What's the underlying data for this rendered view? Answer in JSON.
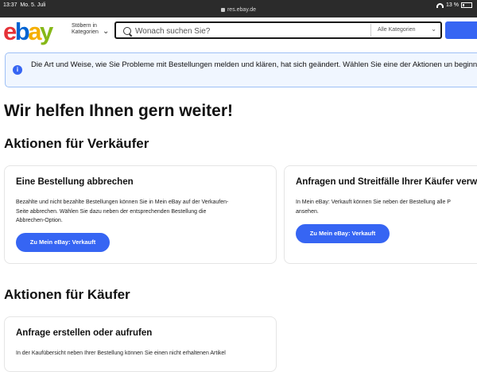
{
  "statusbar": {
    "time": "13:37",
    "date": "Mo. 5. Juli",
    "url": "res.ebay.de",
    "battery": "13 %"
  },
  "header": {
    "logo": [
      "e",
      "b",
      "a",
      "y"
    ],
    "shop_by_category": "Stöbern in Kategorien",
    "search_placeholder": "Wonach suchen Sie?",
    "category_select": "Alle Kategorien"
  },
  "banner": {
    "text": "Die Art und Weise, wie Sie Probleme mit Bestellungen melden und klären, hat sich geändert. Wählen Sie eine der Aktionen un beginnen."
  },
  "page": {
    "title": "Wir helfen Ihnen gern weiter!",
    "seller_heading": "Aktionen für Verkäufer",
    "buyer_heading": "Aktionen für Käufer"
  },
  "seller_cards": [
    {
      "title": "Eine Bestellung abbrechen",
      "body_lines": [
        "Bezahlte und nicht bezahlte Bestellungen können Sie in Mein eBay auf der Verkaufen-",
        "Seite abbrechen. Wählen Sie dazu neben der entsprechenden Bestellung die",
        "Abbrechen-Option."
      ],
      "button": "Zu Mein eBay: Verkauft"
    },
    {
      "title": "Anfragen und Streitfälle Ihrer Käufer verw",
      "body_lines": [
        "In Mein eBay: Verkauft können Sie neben der Bestellung alle P",
        "ansehen."
      ],
      "button": "Zu Mein eBay: Verkauft"
    }
  ],
  "buyer_cards": [
    {
      "title": "Anfrage erstellen oder aufrufen",
      "body_lines": [
        "In der Kaufübersicht neben Ihrer Bestellung können Sie einen nicht erhaltenen Artikel"
      ]
    }
  ]
}
